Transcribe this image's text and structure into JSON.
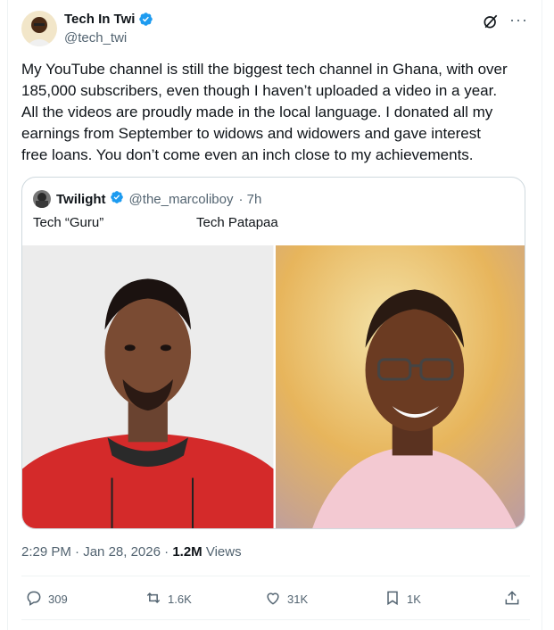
{
  "author": {
    "name": "Tech In Twi",
    "handle": "@tech_twi"
  },
  "tweet": {
    "text": "My YouTube channel is still the biggest tech channel in Ghana, with over\n185,000 subscribers, even though I haven’t uploaded a video in a year.\nAll the videos are proudly made in the local language. I donated all my\nearnings from September to widows and widowers and gave interest\nfree loans. You don’t come even an inch close to my achievements."
  },
  "quote": {
    "name": "Twilight",
    "handle": "@the_marcoliboy",
    "time": "· 7h",
    "caption_left": "Tech “Guru”",
    "caption_right": "Tech Patapaa"
  },
  "meta": {
    "time": "2:29 PM",
    "date": "Jan 28, 2026",
    "views_count": "1.2M",
    "views_label": "Views"
  },
  "actions": {
    "replies": "309",
    "reposts": "1.6K",
    "likes": "31K",
    "bookmarks": "1K"
  },
  "colors": {
    "accent": "#1d9bf0",
    "secondary_text": "#536471",
    "red_hoodie": "#d42a2a",
    "pink_shirt": "#f3c9d2"
  },
  "icons": [
    "verified-badge-icon",
    "grok-icon",
    "more-icon",
    "reply-icon",
    "repost-icon",
    "like-icon",
    "bookmark-icon",
    "share-icon"
  ]
}
